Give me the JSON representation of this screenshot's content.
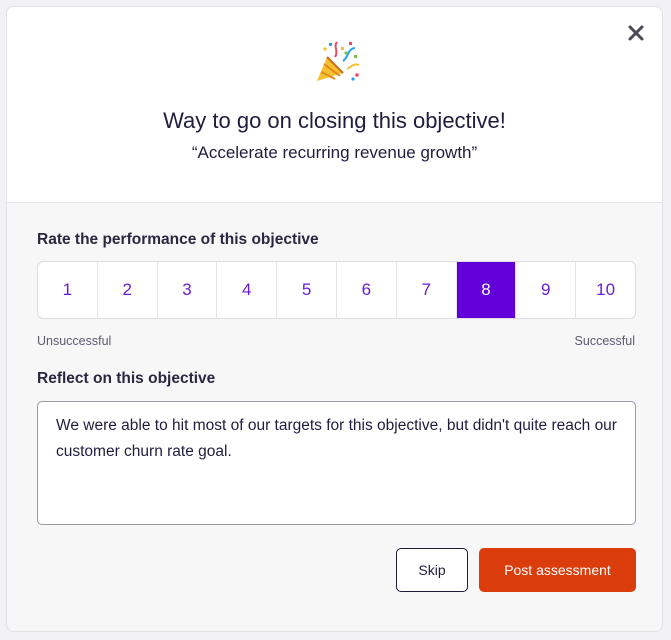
{
  "header": {
    "title": "Way to go on closing this objective!",
    "subtitle": "“Accelerate recurring revenue growth”",
    "icon": "party-popper-icon"
  },
  "rating": {
    "label": "Rate the performance of this objective",
    "options": [
      "1",
      "2",
      "3",
      "4",
      "5",
      "6",
      "7",
      "8",
      "9",
      "10"
    ],
    "selected": "8",
    "min_label": "Unsuccessful",
    "max_label": "Successful"
  },
  "reflection": {
    "label": "Reflect on this objective",
    "value": "We were able to hit most of our targets for this objective, but didn't quite reach our customer churn rate goal."
  },
  "actions": {
    "skip_label": "Skip",
    "post_label": "Post assessment"
  },
  "colors": {
    "accent": "#6200d9",
    "primary_button": "#db3c0c",
    "text": "#1f1d3d"
  }
}
